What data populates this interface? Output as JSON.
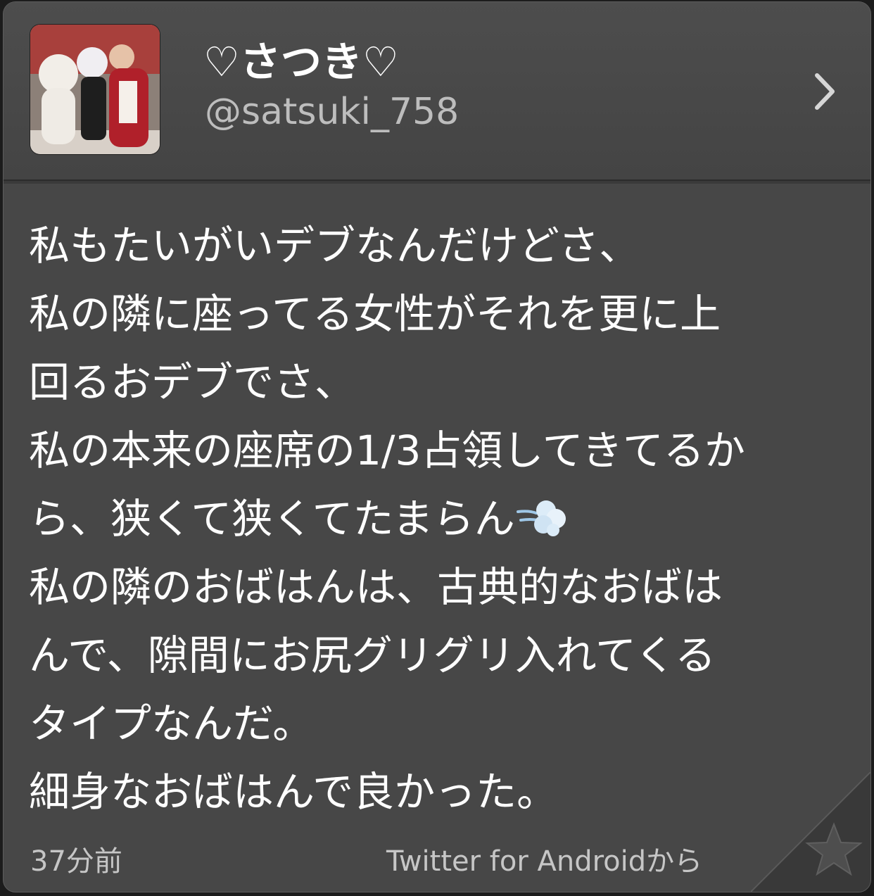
{
  "user": {
    "display_name": "♡さつき♡",
    "handle": "@satsuki_758"
  },
  "tweet": {
    "lines": [
      "私もたいがいデブなんだけどさ、",
      "私の隣に座ってる女性がそれを更に上",
      "回るおデブでさ、",
      "私の本来の座席の1/3占領してきてるか",
      "ら、狭くて狭くてたまらん",
      "私の隣のおばはんは、古典的なおばは",
      "んで、隙間にお尻グリグリ入れてくる",
      "タイプなんだ。",
      "細身なおばはんで良かった。"
    ],
    "timestamp": "37分前",
    "source": "Twitter for Androidから"
  },
  "icons": {
    "chevron": "chevron-right-icon",
    "emoji": "dash-emoji-icon",
    "favorite": "star-icon"
  },
  "colors": {
    "card_background": "#474747",
    "text_primary": "#ffffff",
    "text_secondary": "#bdbdbd"
  }
}
